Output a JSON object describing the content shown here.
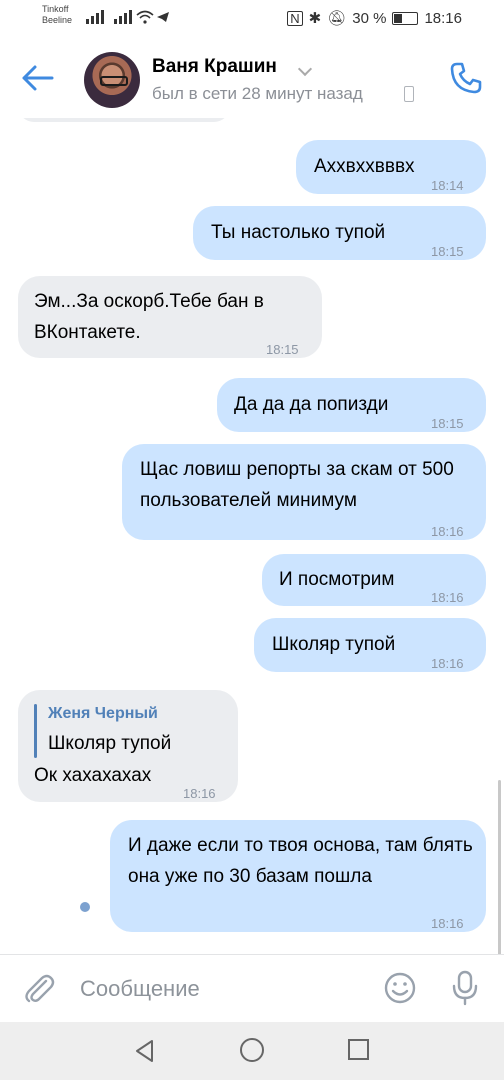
{
  "status_bar": {
    "carrier1": "Tinkoff",
    "carrier2": "Beeline",
    "battery_percent": "30 %",
    "time": "18:16"
  },
  "header": {
    "contact_name": "Ваня Крашин",
    "status": "был в сети 28 минут назад"
  },
  "messages": [
    {
      "dir": "out",
      "text": "Аххвххвввх",
      "time": "18:14"
    },
    {
      "dir": "out",
      "text": "Ты настолько тупой",
      "time": "18:15"
    },
    {
      "dir": "in",
      "text": "Эм...За оскорб.Тебе бан в ВКонтакете.",
      "time": "18:15"
    },
    {
      "dir": "out",
      "text": "Да да да попизди",
      "time": "18:15"
    },
    {
      "dir": "out",
      "text": "Щас ловиш репорты за скам от 500 пользователей минимум",
      "time": "18:16"
    },
    {
      "dir": "out",
      "text": "И посмотрим",
      "time": "18:16"
    },
    {
      "dir": "out",
      "text": "Школяр тупой",
      "time": "18:16"
    },
    {
      "dir": "in",
      "reply_name": "Женя Черный",
      "reply_text": "Школяр тупой",
      "text": "Ок хахахахах",
      "time": "18:16"
    },
    {
      "dir": "out",
      "text": "И даже если то твоя основа, там блять она уже по 30 базам пошла",
      "time": "18:16"
    }
  ],
  "input": {
    "placeholder": "Сообщение"
  },
  "colors": {
    "accent": "#5181b8",
    "outgoing_bubble": "#cce4ff",
    "incoming_bubble": "#ebedf0"
  }
}
